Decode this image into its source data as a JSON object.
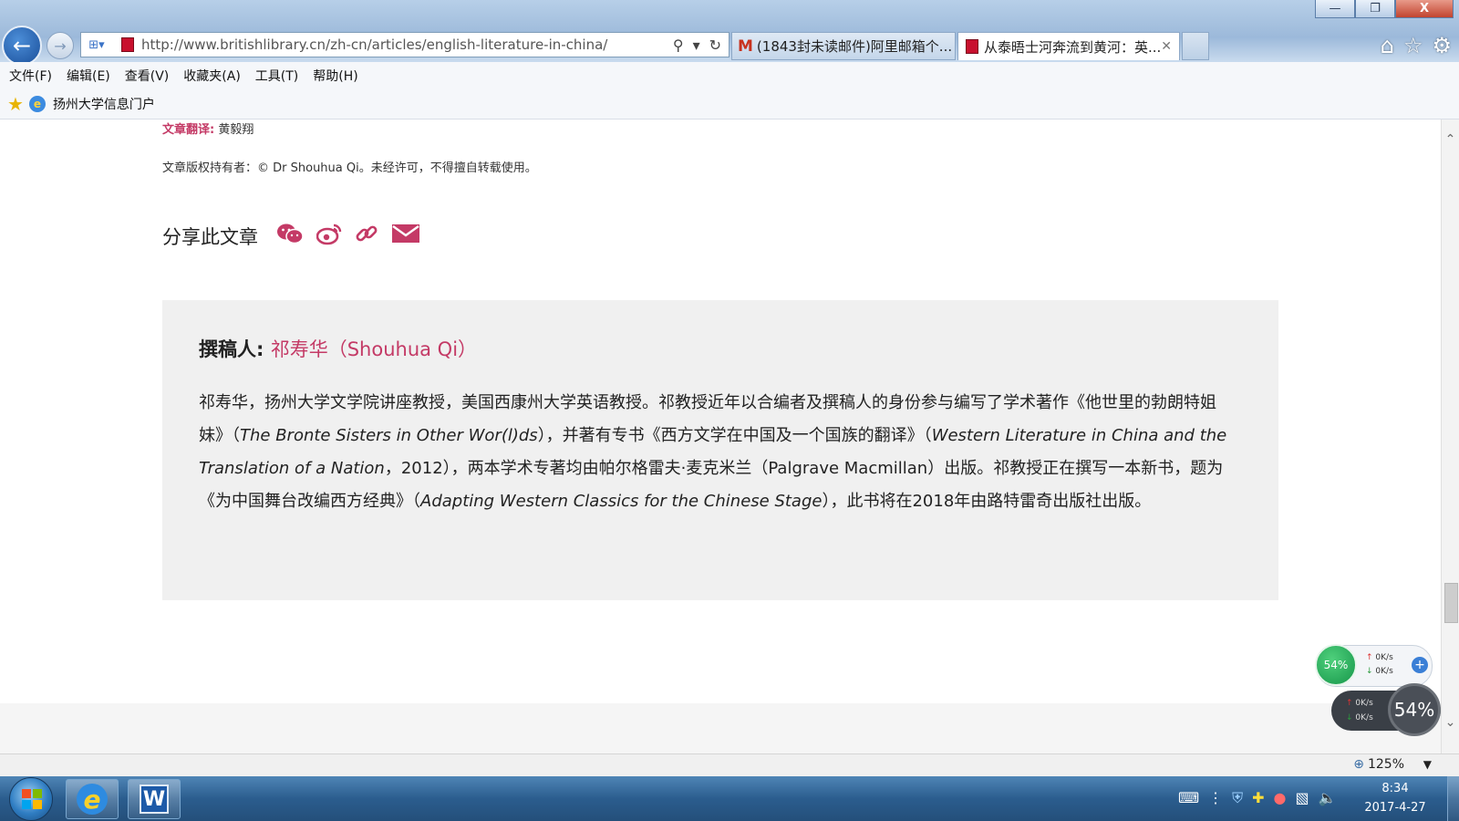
{
  "browser": {
    "address_url": "http://www.britishlibrary.cn/zh-cn/articles/english-literature-in-china/",
    "tabs": [
      {
        "label": "(1843封未读邮件)阿里邮箱个..."
      },
      {
        "label": "从泰晤士河奔流到黄河：英..."
      }
    ],
    "window_buttons": {
      "minimize": "—",
      "maximize": "❐",
      "close": "X"
    }
  },
  "menu": {
    "items": [
      "文件(F)",
      "编辑(E)",
      "查看(V)",
      "收藏夹(A)",
      "工具(T)",
      "帮助(H)"
    ]
  },
  "favorites": {
    "items": [
      {
        "label": "扬州大学信息门户"
      }
    ]
  },
  "article": {
    "translator_label": "文章翻译:",
    "translator_name": "黄毅翔",
    "copyright": "文章版权持有者：© Dr Shouhua Qi。未经许可，不得擅自转载使用。",
    "share_title": "分享此文章",
    "share_icons": [
      "wechat-icon",
      "weibo-icon",
      "link-icon",
      "email-icon"
    ],
    "author": {
      "label": "撰稿人:",
      "name": "祁寿华（Shouhua Qi）",
      "bio_parts": {
        "p1": "祁寿华，扬州大学文学院讲座教授，美国西康州大学英语教授。祁教授近年以合编者及撰稿人的身份参与编写了学术著作《他世里的勃朗特姐妹》（",
        "i1": "The Bronte Sisters in Other Wor(l)ds",
        "p2": "），并著有专书《西方文学在中国及一个国族的翻译》（",
        "i2": "Western Literature in China and the Translation of a Nation",
        "p3": "，2012），两本学术专著均由帕尔格雷夫·麦克米兰（Palgrave Macmillan）出版。祁教授正在撰写一本新书，题为《为中国舞台改编西方经典》（",
        "i3": "Adapting Western Classics for the Chinese Stage",
        "p4": "），此书将在2018年由路特雷奇出版社出版。"
      }
    }
  },
  "net_widget": {
    "percent": "54%",
    "upload": "0K/s",
    "download": "0K/s",
    "dark_upload": "0K/s",
    "dark_download": "0K/s",
    "dark_percent": "54%"
  },
  "statusbar": {
    "zoom": "125%"
  },
  "taskbar": {
    "time": "8:34",
    "date": "2017-4-27"
  },
  "colors": {
    "accent": "#c43a66",
    "author_box_bg": "#f0f0f0"
  }
}
